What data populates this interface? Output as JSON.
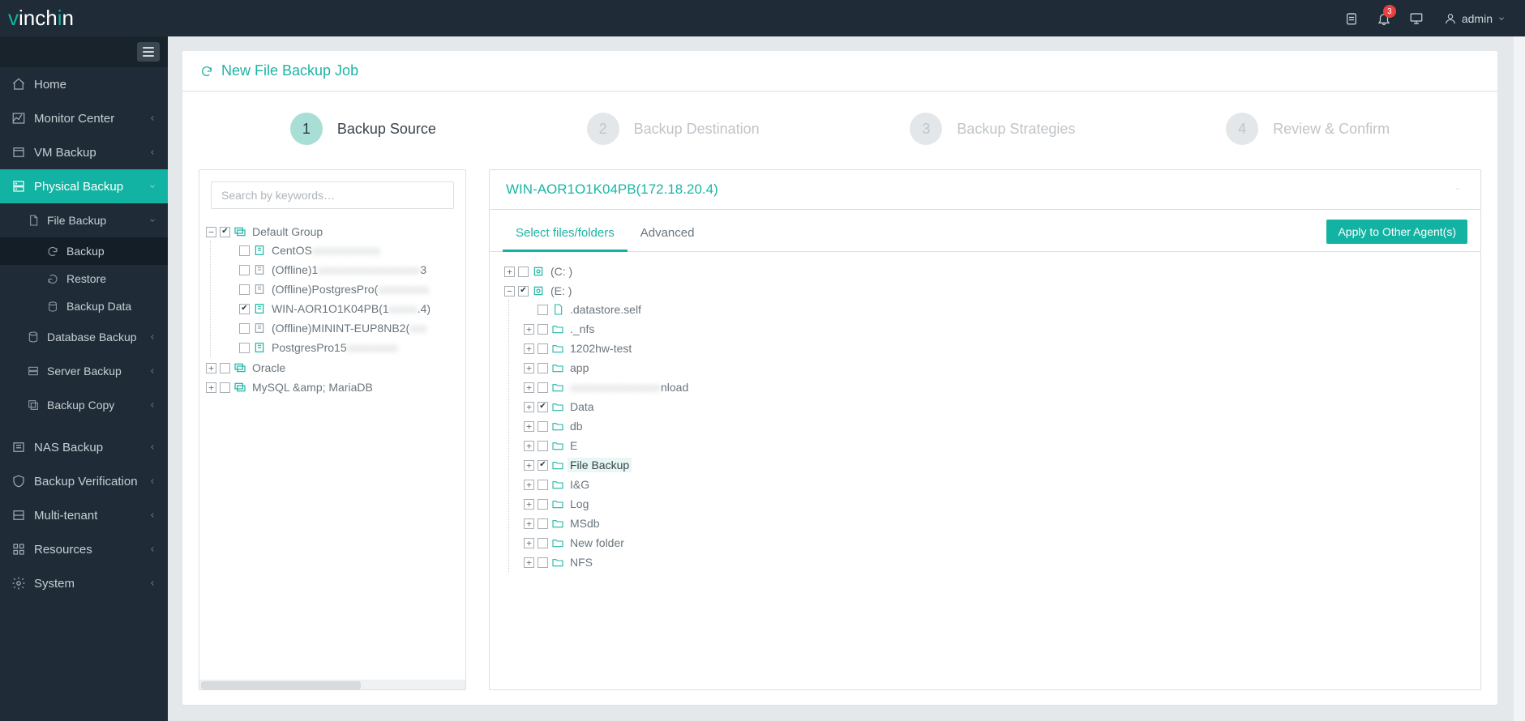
{
  "header": {
    "badge_count": "3",
    "user": "admin"
  },
  "sidebar": {
    "home": "Home",
    "monitor": "Monitor Center",
    "vm_backup": "VM Backup",
    "physical": "Physical Backup",
    "file_backup": "File Backup",
    "backup": "Backup",
    "restore": "Restore",
    "backup_data": "Backup Data",
    "db_backup": "Database Backup",
    "server_backup": "Server Backup",
    "backup_copy": "Backup Copy",
    "nas_backup": "NAS Backup",
    "verification": "Backup Verification",
    "multi_tenant": "Multi-tenant",
    "resources": "Resources",
    "system": "System"
  },
  "page": {
    "title": "New File Backup Job",
    "steps": [
      "Backup Source",
      "Backup Destination",
      "Backup Strategies",
      "Review & Confirm"
    ]
  },
  "left_tree": {
    "search_placeholder": "Search by keywords…",
    "default_group": "Default Group",
    "nodes": {
      "centos": "CentOS",
      "off1": "(Offline)1",
      "off1_suffix": "3",
      "off2": "(Offline)PostgresPro(",
      "win": "WIN-AOR1O1K04PB(1",
      "win_suffix": ".4)",
      "off3": "(Offline)MININT-EUP8NB2(",
      "pg15": "PostgresPro15"
    },
    "oracle": "Oracle",
    "mysql": "MySQL &amp; MariaDB"
  },
  "right": {
    "title": "WIN-AOR1O1K04PB(172.18.20.4)",
    "tab_files": "Select files/folders",
    "tab_adv": "Advanced",
    "apply": "Apply to Other Agent(s)",
    "drive_c": "(C: )",
    "drive_e": "(E: )",
    "ds": ".datastore.self",
    "folders": {
      "nfs": "._nfs",
      "hw": "1202hw-test",
      "app": "app",
      "dl_suffix": "nload",
      "data": "Data",
      "db": "db",
      "e": "E",
      "fb": "File Backup",
      "ig": "I&G",
      "log": "Log",
      "msdb": "MSdb",
      "nf": "New folder",
      "nfs2": "NFS"
    }
  }
}
